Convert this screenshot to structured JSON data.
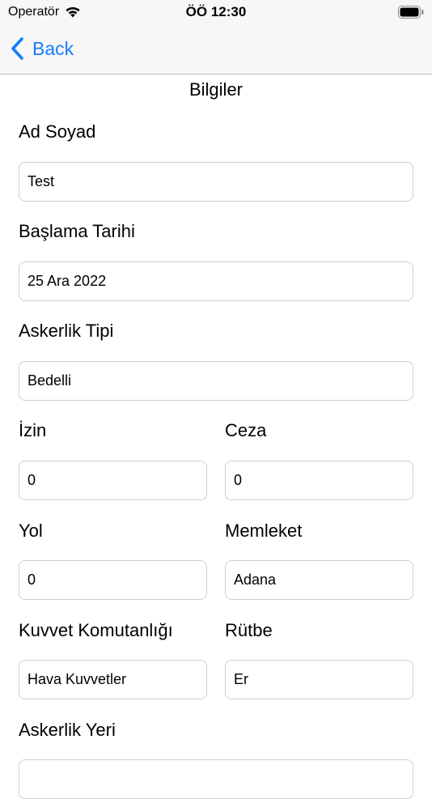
{
  "status_bar": {
    "carrier": "Operatör",
    "time": "ÖÖ 12:30",
    "wifi_icon": "wifi-icon",
    "battery_icon": "battery-icon"
  },
  "nav": {
    "back_label": "Back",
    "back_icon": "chevron-left-icon",
    "accent_color": "#157efb"
  },
  "form": {
    "title": "Bilgiler",
    "ad_soyad": {
      "label": "Ad Soyad",
      "value": "Test"
    },
    "baslama_tarihi": {
      "label": "Başlama Tarihi",
      "value": "25 Ara 2022"
    },
    "askerlik_tipi": {
      "label": "Askerlik Tipi",
      "value": "Bedelli"
    },
    "izin": {
      "label": "İzin",
      "value": "0"
    },
    "ceza": {
      "label": "Ceza",
      "value": "0"
    },
    "yol": {
      "label": "Yol",
      "value": "0"
    },
    "memleket": {
      "label": "Memleket",
      "value": "Adana"
    },
    "kuvvet_komutanligi": {
      "label": "Kuvvet Komutanlığı",
      "value": "Hava Kuvvetler"
    },
    "rutbe": {
      "label": "Rütbe",
      "value": "Er"
    },
    "askerlik_yeri": {
      "label": "Askerlik Yeri",
      "value": ""
    }
  }
}
